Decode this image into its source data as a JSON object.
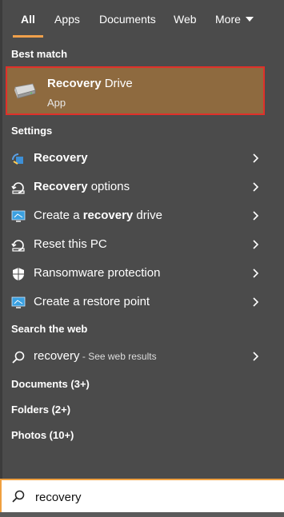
{
  "tabs": {
    "all": "All",
    "apps": "Apps",
    "documents": "Documents",
    "web": "Web",
    "more": "More"
  },
  "best_match": {
    "section": "Best match",
    "title_bold": "Recovery",
    "title_rest": " Drive",
    "subtitle": "App"
  },
  "settings": {
    "section": "Settings",
    "items": [
      {
        "pre": "",
        "bold": "Recovery",
        "post": ""
      },
      {
        "pre": "",
        "bold": "Recovery",
        "post": " options"
      },
      {
        "pre": "Create a ",
        "bold": "recovery",
        "post": " drive"
      },
      {
        "pre": "Reset this PC",
        "bold": "",
        "post": ""
      },
      {
        "pre": "Ransomware protection",
        "bold": "",
        "post": ""
      },
      {
        "pre": "Create a restore point",
        "bold": "",
        "post": ""
      }
    ]
  },
  "web": {
    "section": "Search the web",
    "query": "recovery",
    "suffix": " - See web results"
  },
  "groups": {
    "documents": "Documents (3+)",
    "folders": "Folders (2+)",
    "photos": "Photos (10+)"
  },
  "search": {
    "value": "recovery"
  },
  "colors": {
    "accent": "#f0a04b",
    "highlight_bg": "#8e6a3f",
    "highlight_border": "#e0302a",
    "panel_bg": "#4b4b4b"
  }
}
